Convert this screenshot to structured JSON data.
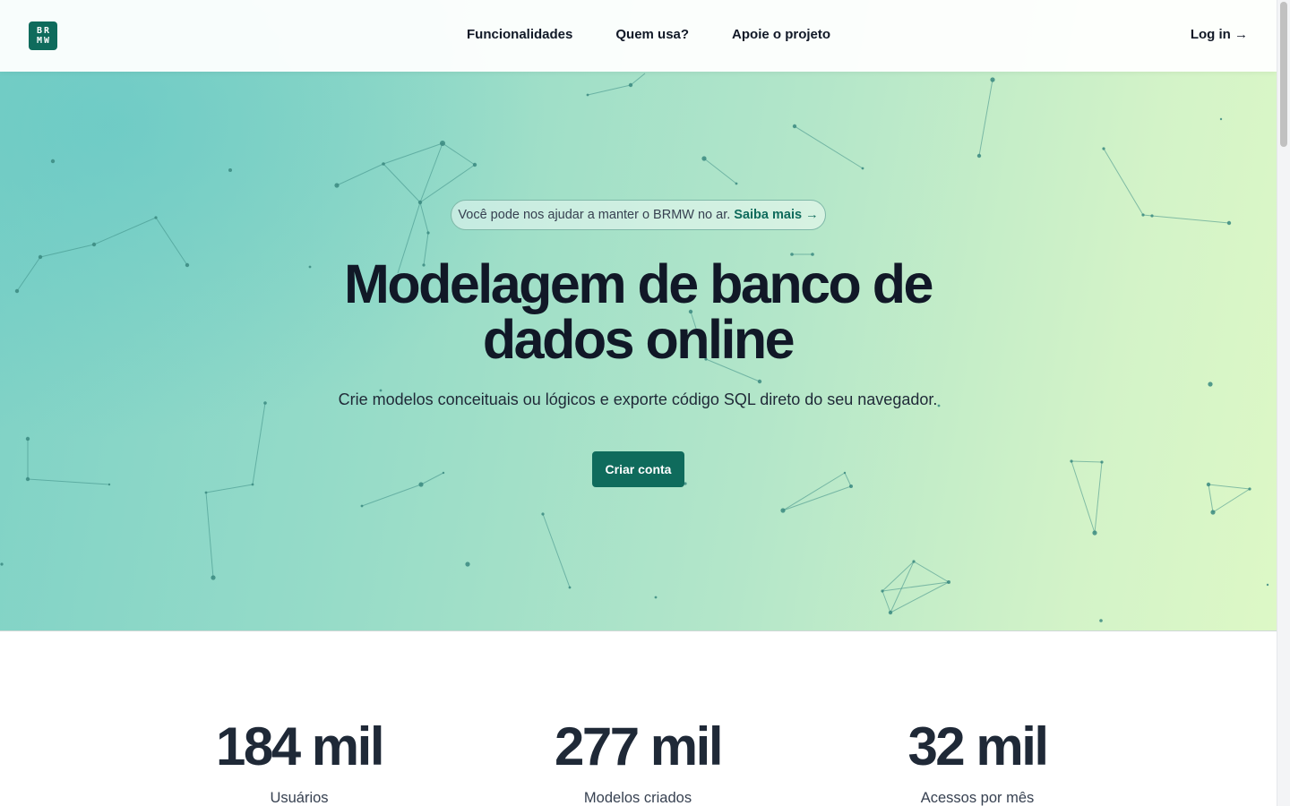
{
  "navbar": {
    "logo_lines": [
      "BR",
      "MW"
    ],
    "links": [
      "Funcionalidades",
      "Quem usa?",
      "Apoie o projeto"
    ],
    "login": "Log in →"
  },
  "hero": {
    "banner_text": "Você pode nos ajudar a manter o BRMW no ar.",
    "banner_link": "Saiba mais →",
    "title": "Modelagem de banco de dados online",
    "subtitle": "Crie modelos conceituais ou lógicos e exporte código SQL direto do seu navegador.",
    "cta": "Criar conta"
  },
  "stats": [
    {
      "value": "184 mil",
      "label": "Usuários"
    },
    {
      "value": "277 mil",
      "label": "Modelos criados"
    },
    {
      "value": "32 mil",
      "label": "Acessos por mês"
    }
  ],
  "colors": {
    "brand": "#0f6b5c",
    "text": "#111827",
    "hero_gradient_start": "#7dd1c6",
    "hero_gradient_end": "#ddf8c6"
  }
}
